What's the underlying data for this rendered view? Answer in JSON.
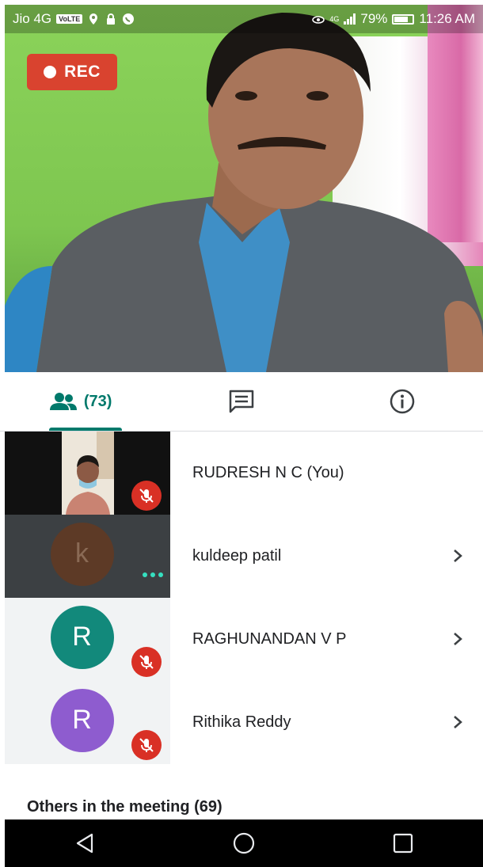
{
  "status_bar": {
    "carrier": "Jio 4G",
    "volte_badge": "VoLTE",
    "network_type": "4G",
    "battery": "79%",
    "time": "11:26 AM",
    "icons": [
      "location-icon",
      "lock-icon",
      "whatsapp-icon",
      "eye-icon",
      "signal-icon",
      "battery-icon"
    ]
  },
  "video": {
    "rec_label": "REC",
    "rec_color": "#d9432f"
  },
  "tabs": {
    "people_count": "(73)",
    "items": [
      "people-tab",
      "chat-tab",
      "info-tab"
    ],
    "accent_color": "#00796b"
  },
  "participants": [
    {
      "name": "RUDRESH N C (You)",
      "tile": "self-video",
      "muted": true,
      "chevron": false
    },
    {
      "name": "kuldeep patil",
      "avatar_letter": "k",
      "avatar_color": "#5d3a26",
      "muted": false,
      "more_dots": true,
      "chevron": true
    },
    {
      "name": "RAGHUNANDAN V P",
      "avatar_letter": "R",
      "avatar_color": "#12897b",
      "muted": true,
      "chevron": true
    },
    {
      "name": "Rithika Reddy",
      "avatar_letter": "R",
      "avatar_color": "#8e5ccf",
      "muted": true,
      "chevron": true
    }
  ],
  "others_heading": "Others in the meeting (69)",
  "nav_bar": {
    "buttons": [
      "back-icon",
      "home-icon",
      "recents-icon"
    ]
  }
}
